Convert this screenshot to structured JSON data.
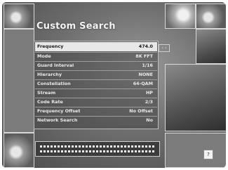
{
  "title": "Custom Search",
  "menu": {
    "rows": [
      {
        "label": "Frequency",
        "value": "474.0"
      },
      {
        "label": "Mode",
        "value": "8K FFT"
      },
      {
        "label": "Guard Interval",
        "value": "1/16"
      },
      {
        "label": "Hierarchy",
        "value": "NONE"
      },
      {
        "label": "Constellation",
        "value": "64-QAM"
      },
      {
        "label": "Stream",
        "value": "HP"
      },
      {
        "label": "Code Rate",
        "value": "2/3"
      },
      {
        "label": "Frequency Offset",
        "value": "No Offset"
      },
      {
        "label": "Network Search",
        "value": "No"
      }
    ],
    "selected_index": 0
  },
  "nav_indicator": "‹ ›",
  "corner_badge": "?",
  "colors": {
    "accent": "#e8e8e8",
    "panel": "#464646",
    "text": "#e9e9e9"
  },
  "icons": [
    "left-right-arrow-icon",
    "help-icon"
  ]
}
